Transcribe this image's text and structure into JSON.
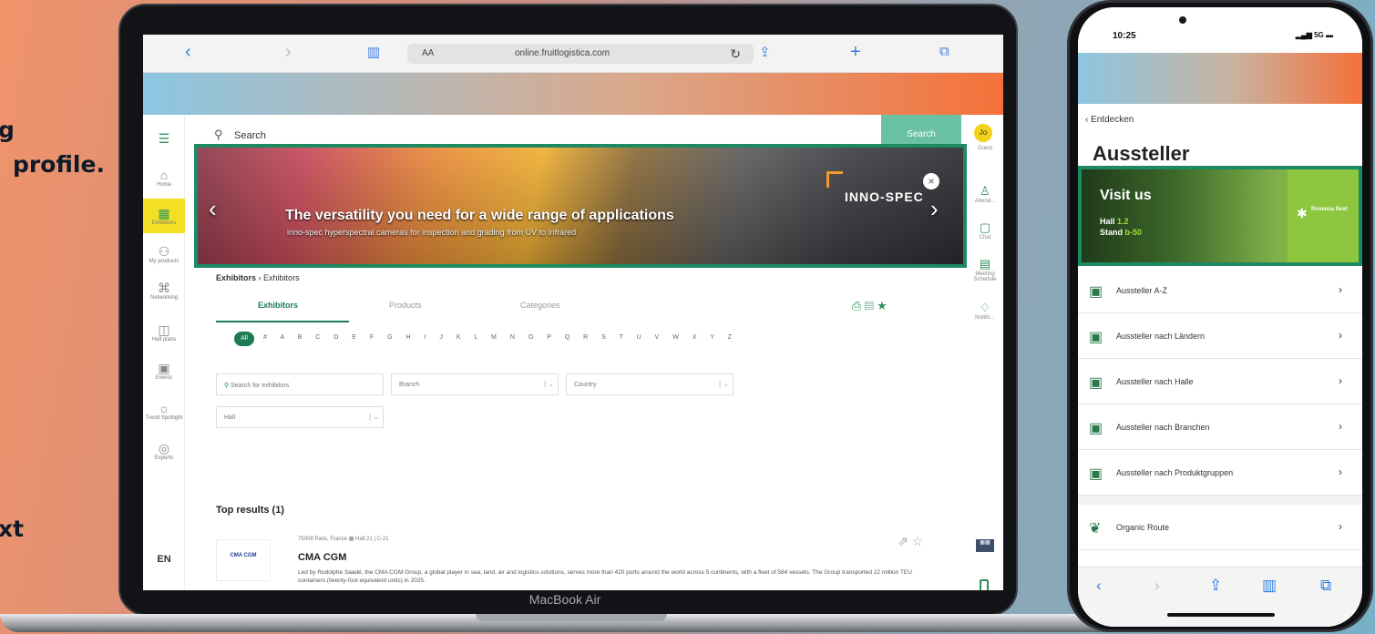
{
  "side_text": {
    "line1": "g",
    "line2": "profile.",
    "line3": "xt"
  },
  "laptop": {
    "label": "MacBook Air",
    "browser": {
      "aa": "AA",
      "url": "online.fruitlogistica.com",
      "reload": "↻"
    },
    "search": {
      "placeholder": "Search",
      "button": "Search"
    },
    "left_nav": [
      {
        "label": "",
        "icon": "☰"
      },
      {
        "label": "Home",
        "icon": "⌂"
      },
      {
        "label": "Exhibitors",
        "icon": "▦"
      },
      {
        "label": "My products",
        "icon": "⚇"
      },
      {
        "label": "Networking",
        "icon": "⌘"
      },
      {
        "label": "Hall plans",
        "icon": "◫"
      },
      {
        "label": "Events",
        "icon": "▣"
      },
      {
        "label": "Trend Spotlight",
        "icon": "☼"
      },
      {
        "label": "Experts",
        "icon": "◎"
      }
    ],
    "lang": "EN",
    "right_nav": [
      {
        "label": "Guest",
        "icon": "Jo"
      },
      {
        "label": "Attend...",
        "icon": "♙"
      },
      {
        "label": "Chat",
        "icon": "▢"
      },
      {
        "label": "Meeting Schedule",
        "icon": "▤"
      },
      {
        "label": "Notific...",
        "icon": "♢"
      }
    ],
    "banner": {
      "headline": "The versatility you need for a wide range of applications",
      "sub": "inno-spec hyperspectral cameras for inspection and grading from UV to infrared",
      "brand": "INNO-SPEC",
      "close": "×",
      "prev": "‹",
      "next": "›"
    },
    "breadcrumb": {
      "first": "Exhibitors",
      "sep": "›",
      "second": "Exhibitors"
    },
    "tabs": [
      "Exhibitors",
      "Products",
      "Categories"
    ],
    "alphabet": {
      "all": "All",
      "letters": "# A B C D E F G H I J K L M N O P Q R S T U V W X Y Z"
    },
    "filters": {
      "search": "Search for exhibitors",
      "branch": "Branch",
      "country": "Country",
      "hall": "Hall"
    },
    "top_results": "Top results (1)",
    "company": {
      "logo": "CMA CGM",
      "location": "75008 Paris, France  ▦ Hall 21 | C-21",
      "name": "CMA CGM",
      "description": "Led by Rodolphe Saadé, the CMA CGM Group, a global player in sea, land, air and logistics solutions, serves more than 420 ports around the world across 5 continents, with a fleet of 584 vessels. The Group transported 22 million TEU containers (twenty-foot equivalent units) in 2025."
    }
  },
  "phone": {
    "time": "10:25",
    "signal": "5G",
    "back": "Entdecken",
    "title": "Aussteller",
    "banner": {
      "visit": "Visit us",
      "hall_label": "Hall",
      "hall": "1.2",
      "stand_label": "Stand",
      "stand": "b-50",
      "brand": "Rovensa Next"
    },
    "items": [
      "Aussteller A-Z",
      "Aussteller nach Ländern",
      "Aussteller nach Halle",
      "Aussteller nach Branchen",
      "Aussteller nach Produktgruppen",
      "Organic Route"
    ]
  },
  "colors": {
    "accent": "#1e8a62",
    "highlight": "#f3df24",
    "link": "#2f7de0"
  }
}
